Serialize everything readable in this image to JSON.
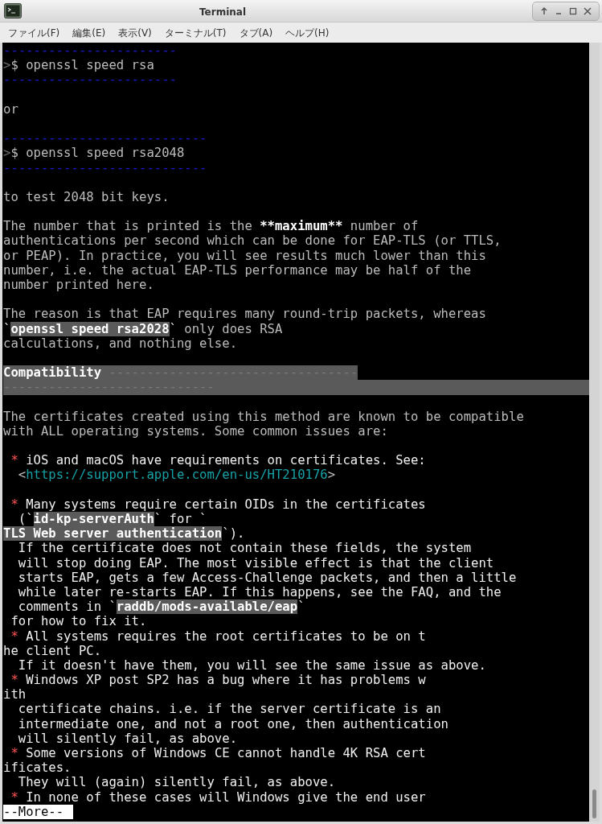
{
  "window": {
    "title": "Terminal"
  },
  "menu": [
    "ファイル(F)",
    "編集(E)",
    "表示(V)",
    "ターミナル(T)",
    "タブ(A)",
    "ヘルプ(H)"
  ],
  "terminal": {
    "lines": [
      {
        "kind": "rule",
        "segments": [
          {
            "kind": "rule",
            "text": "-----------------------"
          }
        ]
      },
      {
        "kind": "text",
        "segments": [
          {
            "kind": "dim",
            "text": ">"
          },
          {
            "kind": "plain",
            "text": "$ openssl speed rsa"
          }
        ]
      },
      {
        "kind": "rule",
        "segments": [
          {
            "kind": "rule",
            "text": "-----------------------"
          }
        ]
      },
      {
        "kind": "blank"
      },
      {
        "kind": "text",
        "segments": [
          {
            "kind": "plain",
            "text": "or"
          }
        ]
      },
      {
        "kind": "blank"
      },
      {
        "kind": "rule",
        "segments": [
          {
            "kind": "rule",
            "text": "---------------------------"
          }
        ]
      },
      {
        "kind": "text",
        "segments": [
          {
            "kind": "dim",
            "text": ">"
          },
          {
            "kind": "plain",
            "text": "$ openssl speed rsa2048"
          }
        ]
      },
      {
        "kind": "rule",
        "segments": [
          {
            "kind": "rule",
            "text": "---------------------------"
          }
        ]
      },
      {
        "kind": "blank"
      },
      {
        "kind": "text",
        "segments": [
          {
            "kind": "plain",
            "text": "to test 2048 bit keys."
          }
        ]
      },
      {
        "kind": "blank"
      },
      {
        "kind": "text",
        "segments": [
          {
            "kind": "plain",
            "text": "The number that is printed is the "
          },
          {
            "kind": "bold",
            "text": "**maximum**"
          },
          {
            "kind": "plain",
            "text": " number of"
          }
        ]
      },
      {
        "kind": "text",
        "segments": [
          {
            "kind": "plain",
            "text": "authentications per second which can be done for EAP-TLS (or TTLS,"
          }
        ]
      },
      {
        "kind": "text",
        "segments": [
          {
            "kind": "plain",
            "text": "or PEAP). In practice, you will see results much lower than this"
          }
        ]
      },
      {
        "kind": "text",
        "segments": [
          {
            "kind": "plain",
            "text": "number, i.e. the actual EAP-TLS performance may be half of the"
          }
        ]
      },
      {
        "kind": "text",
        "segments": [
          {
            "kind": "plain",
            "text": "number printed here."
          }
        ]
      },
      {
        "kind": "blank"
      },
      {
        "kind": "text",
        "segments": [
          {
            "kind": "plain",
            "text": "The reason is that EAP requires many round-trip packets, whereas"
          }
        ]
      },
      {
        "kind": "text",
        "segments": [
          {
            "kind": "bright",
            "text": "`"
          },
          {
            "kind": "code",
            "text": "openssl speed rsa2028"
          },
          {
            "kind": "bright",
            "text": "`"
          },
          {
            "kind": "plain",
            "text": " only does RSA"
          }
        ]
      },
      {
        "kind": "text",
        "segments": [
          {
            "kind": "plain",
            "text": "calculations, and nothing else."
          }
        ]
      },
      {
        "kind": "blank"
      },
      {
        "kind": "heading",
        "segments": [
          {
            "kind": "heading",
            "text": "Compatibility"
          },
          {
            "kind": "heading_rule",
            "text": " ---------------------------------"
          }
        ]
      },
      {
        "kind": "heading_wrap",
        "segments": [
          {
            "kind": "heading_rule",
            "text": "----------------------------"
          }
        ]
      },
      {
        "kind": "blank"
      },
      {
        "kind": "text",
        "segments": [
          {
            "kind": "plain",
            "text": "The certificates created using this method are known to be compatible"
          }
        ]
      },
      {
        "kind": "text",
        "segments": [
          {
            "kind": "plain",
            "text": "with ALL operating systems. Some common issues are:"
          }
        ]
      },
      {
        "kind": "blank"
      },
      {
        "kind": "text",
        "segments": [
          {
            "kind": "bullet",
            "text": " *"
          },
          {
            "kind": "bright",
            "text": " iOS and macOS have requirements on certificates. See:"
          }
        ]
      },
      {
        "kind": "text",
        "segments": [
          {
            "kind": "plain",
            "text": "  <"
          },
          {
            "kind": "link",
            "text": "https://support.apple.com/en-us/HT210176"
          },
          {
            "kind": "plain",
            "text": ">"
          }
        ]
      },
      {
        "kind": "blank"
      },
      {
        "kind": "text",
        "segments": [
          {
            "kind": "bullet",
            "text": " *"
          },
          {
            "kind": "bright",
            "text": " Many systems require certain OIDs in the certificates"
          }
        ]
      },
      {
        "kind": "text",
        "segments": [
          {
            "kind": "bright",
            "text": "  (`"
          },
          {
            "kind": "code",
            "text": "id-kp-serverAuth"
          },
          {
            "kind": "bright",
            "text": "` for `"
          }
        ]
      },
      {
        "kind": "text",
        "segments": [
          {
            "kind": "code",
            "text": "TLS Web server authentication"
          },
          {
            "kind": "bright",
            "text": "`)."
          }
        ]
      },
      {
        "kind": "text",
        "segments": [
          {
            "kind": "bright",
            "text": "  If the certificate does not contain these fields, the system"
          }
        ]
      },
      {
        "kind": "text",
        "segments": [
          {
            "kind": "bright",
            "text": "  will stop doing EAP. The most visible effect is that the client"
          }
        ]
      },
      {
        "kind": "text",
        "segments": [
          {
            "kind": "bright",
            "text": "  starts EAP, gets a few Access-Challenge packets, and then a little"
          }
        ]
      },
      {
        "kind": "text",
        "segments": [
          {
            "kind": "bright",
            "text": "  while later re-starts EAP. If this happens, see the FAQ, and the"
          }
        ]
      },
      {
        "kind": "text",
        "segments": [
          {
            "kind": "bright",
            "text": "  comments in `"
          },
          {
            "kind": "code",
            "text": "raddb/mods-available/eap"
          },
          {
            "kind": "bright",
            "text": "`"
          }
        ]
      },
      {
        "kind": "text",
        "segments": [
          {
            "kind": "bright",
            "text": " for how to fix it."
          }
        ]
      },
      {
        "kind": "text",
        "segments": [
          {
            "kind": "bullet",
            "text": " *"
          },
          {
            "kind": "bright",
            "text": " All systems requires the root certificates to be on t"
          }
        ]
      },
      {
        "kind": "text",
        "segments": [
          {
            "kind": "bright",
            "text": "he client PC."
          }
        ]
      },
      {
        "kind": "text",
        "segments": [
          {
            "kind": "bright",
            "text": "  If it doesn't have them, you will see the same issue as above."
          }
        ]
      },
      {
        "kind": "text",
        "segments": [
          {
            "kind": "bullet",
            "text": " *"
          },
          {
            "kind": "bright",
            "text": " Windows XP post SP2 has a bug where it has problems w"
          }
        ]
      },
      {
        "kind": "text",
        "segments": [
          {
            "kind": "bright",
            "text": "ith"
          }
        ]
      },
      {
        "kind": "text",
        "segments": [
          {
            "kind": "bright",
            "text": "  certificate chains. i.e. if the server certificate is an"
          }
        ]
      },
      {
        "kind": "text",
        "segments": [
          {
            "kind": "bright",
            "text": "  intermediate one, and not a root one, then authentication"
          }
        ]
      },
      {
        "kind": "text",
        "segments": [
          {
            "kind": "bright",
            "text": "  will silently fail, as above."
          }
        ]
      },
      {
        "kind": "text",
        "segments": [
          {
            "kind": "bullet",
            "text": " *"
          },
          {
            "kind": "bright",
            "text": " Some versions of Windows CE cannot handle 4K RSA cert"
          }
        ]
      },
      {
        "kind": "text",
        "segments": [
          {
            "kind": "bright",
            "text": "ificates."
          }
        ]
      },
      {
        "kind": "text",
        "segments": [
          {
            "kind": "bright",
            "text": "  They will (again) silently fail, as above."
          }
        ]
      },
      {
        "kind": "text",
        "segments": [
          {
            "kind": "bullet",
            "text": " *"
          },
          {
            "kind": "bright",
            "text": " In none of these cases will Windows give the end user"
          }
        ]
      }
    ],
    "pager_prompt": "--More--"
  }
}
